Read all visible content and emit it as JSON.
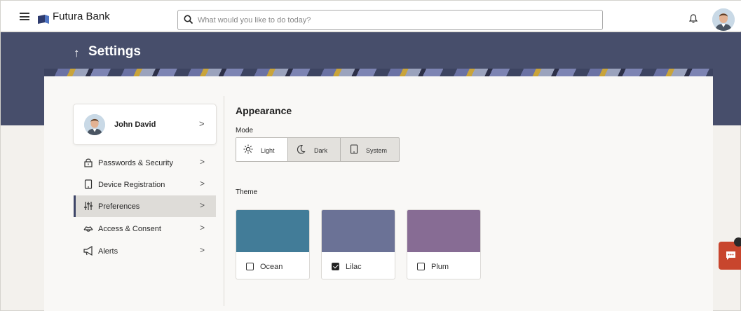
{
  "header": {
    "brand": "Futura Bank",
    "search_placeholder": "What would you like to do today?"
  },
  "page": {
    "back_arrow": "↑",
    "title": "Settings"
  },
  "profile": {
    "name": "John David"
  },
  "nav": {
    "chevron": ">",
    "items": [
      {
        "label": "Passwords & Security",
        "icon": "lock-icon"
      },
      {
        "label": "Device Registration",
        "icon": "device-icon"
      },
      {
        "label": "Preferences",
        "icon": "sliders-icon",
        "active": true
      },
      {
        "label": "Access & Consent",
        "icon": "handshake-icon"
      },
      {
        "label": "Alerts",
        "icon": "megaphone-icon"
      }
    ]
  },
  "appearance": {
    "title": "Appearance",
    "mode_label": "Mode",
    "modes": [
      {
        "label": "Light",
        "icon": "sun-icon",
        "selected": true
      },
      {
        "label": "Dark",
        "icon": "moon-icon",
        "selected": false
      },
      {
        "label": "System",
        "icon": "device-icon",
        "selected": false
      }
    ],
    "theme_label": "Theme",
    "themes": [
      {
        "name": "Ocean",
        "color": "#427c98",
        "checked": false
      },
      {
        "name": "Lilac",
        "color": "#6b7296",
        "checked": true
      },
      {
        "name": "Plum",
        "color": "#876c94",
        "checked": false
      }
    ]
  },
  "colors": {
    "hero": "#474e6b",
    "chat": "#c8452d"
  }
}
